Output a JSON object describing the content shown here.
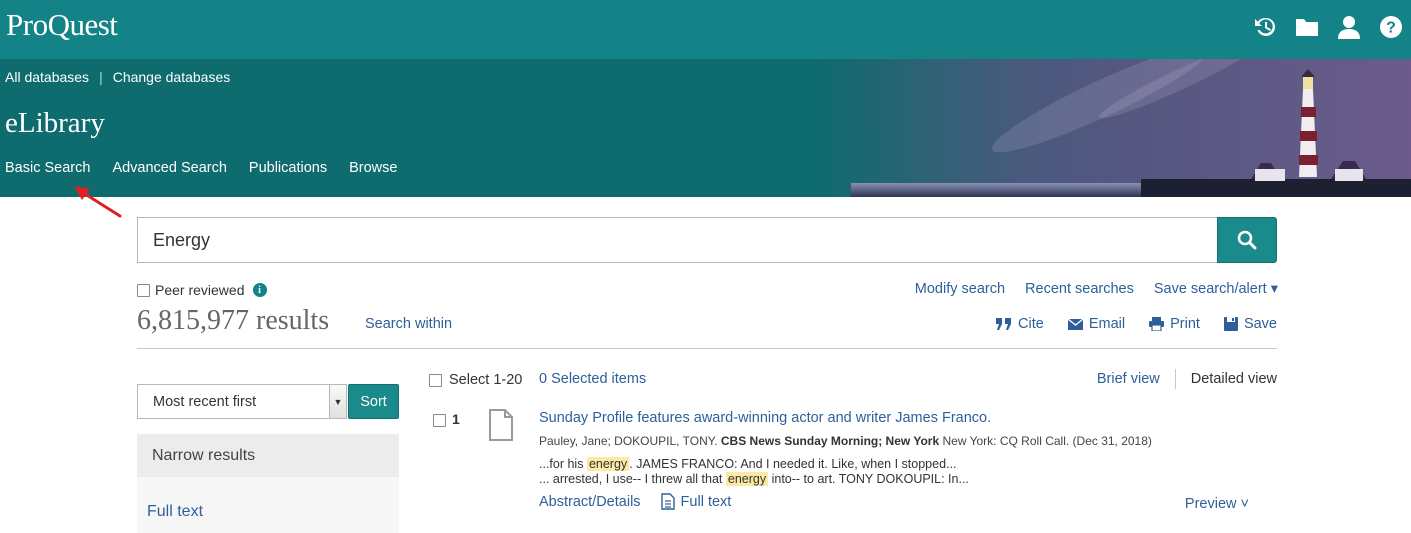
{
  "header": {
    "logo": "ProQuest",
    "icons": [
      "history-icon",
      "folder-icon",
      "user-icon",
      "help-icon"
    ]
  },
  "banner": {
    "all_databases": "All databases",
    "change_databases": "Change databases",
    "product_title": "eLibrary",
    "nav": {
      "basic_search": "Basic Search",
      "advanced_search": "Advanced Search",
      "publications": "Publications",
      "browse": "Browse"
    }
  },
  "search": {
    "query": "Energy",
    "peer_reviewed_label": "Peer reviewed",
    "modify_search": "Modify search",
    "recent_searches": "Recent searches",
    "save_search_alert": "Save search/alert ▾"
  },
  "results": {
    "count_text": "6,815,977 results",
    "search_within": "Search within",
    "actions": {
      "cite": "Cite",
      "email": "Email",
      "print": "Print",
      "save": "Save"
    },
    "select_range": "Select 1-20",
    "selected_items": "0 Selected items",
    "brief_view": "Brief view",
    "detailed_view": "Detailed view"
  },
  "sidebar": {
    "sort_value": "Most recent first",
    "sort_button": "Sort",
    "narrow_results": "Narrow results",
    "full_text_facet": "Full text"
  },
  "items": [
    {
      "number": "1",
      "title": "Sunday Profile features award-winning actor and writer James Franco.",
      "authors": "Pauley, Jane; DOKOUPIL, TONY.",
      "source_bold": "CBS News Sunday Morning; New York",
      "source_rest": "New York: CQ Roll Call. (Dec 31, 2018)",
      "snippet1_pre": "...for his",
      "snippet1_hl": "energy",
      "snippet1_post": ". JAMES FRANCO: And I needed it. Like, when I stopped...",
      "snippet2_pre": "... arrested, I use-- I threw all that",
      "snippet2_hl": "energy",
      "snippet2_post": "into-- to art. TONY DOKOUPIL: In...",
      "abstract_link": "Abstract/Details",
      "fulltext_link": "Full text",
      "preview": "Preview ˅"
    }
  ],
  "colors": {
    "brand_teal": "#138387",
    "link_blue": "#2e5f9a",
    "highlight": "#fbe9a4",
    "annotation_arrow": "#e02020"
  }
}
